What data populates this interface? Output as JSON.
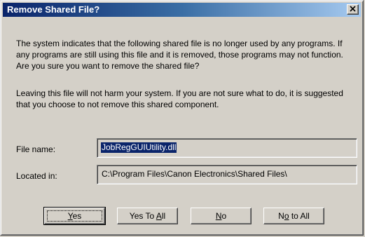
{
  "dialog": {
    "title": "Remove Shared File?",
    "message1": "The system indicates that the following shared file is no longer used by any programs.  If any programs are still using this file and it is removed, those programs may not function.  Are you sure you want to remove the shared file?",
    "message2": "Leaving this file will not harm your system.  If you are not sure what to do, it is suggested that you choose to not remove this shared component."
  },
  "fields": {
    "file_name_label": "File name:",
    "file_name_value": "JobRegGUIUtility.dll",
    "located_in_label": "Located in:",
    "located_in_value": "C:\\Program Files\\Canon Electronics\\Shared Files\\"
  },
  "buttons": {
    "yes": {
      "pre": "",
      "key": "Y",
      "post": "es"
    },
    "yes_to_all": {
      "pre": "Yes To ",
      "key": "A",
      "post": "ll"
    },
    "no": {
      "pre": "",
      "key": "N",
      "post": "o"
    },
    "no_to_all": {
      "pre": "N",
      "key": "o",
      "post": " to All"
    }
  },
  "icons": {
    "close": "close-icon"
  },
  "colors": {
    "title_start": "#0a246a",
    "title_end": "#a6caf0",
    "face": "#d4d0c8",
    "selection": "#0a246a"
  }
}
